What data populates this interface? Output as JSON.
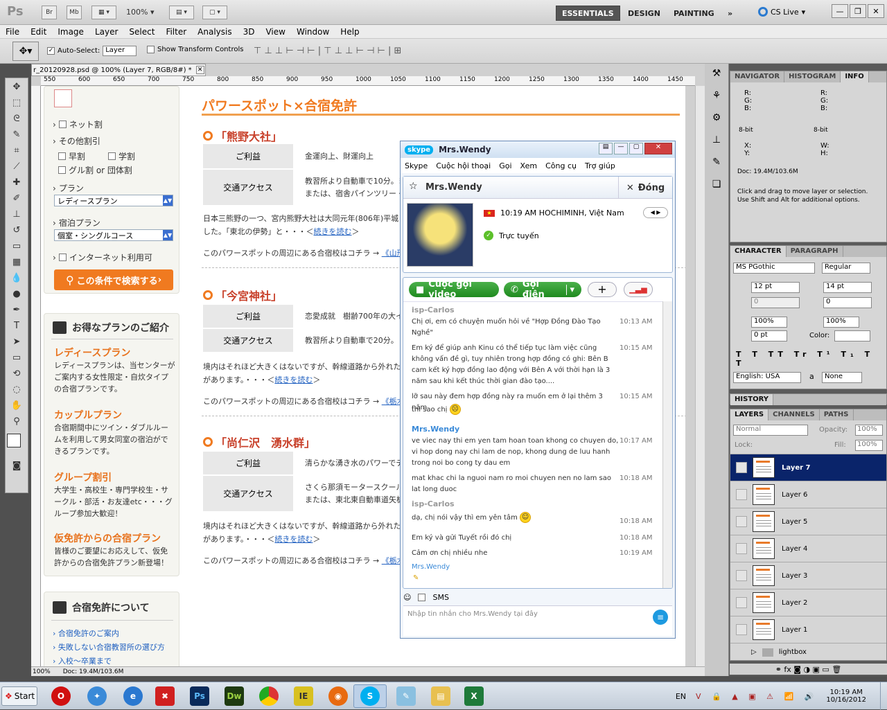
{
  "ps": {
    "logo": "Ps",
    "top_buttons": [
      "Br",
      "Mb"
    ],
    "zoom": "100%",
    "workspaces": [
      "ESSENTIALS",
      "DESIGN",
      "PAINTING"
    ],
    "more_workspaces": "»",
    "cs_live": "CS Live",
    "menu": [
      "File",
      "Edit",
      "Image",
      "Layer",
      "Select",
      "Filter",
      "Analysis",
      "3D",
      "View",
      "Window",
      "Help"
    ],
    "options": {
      "auto_select_label": "Auto-Select:",
      "auto_select_value": "Layer",
      "show_transform": "Show Transform Controls"
    },
    "doc_tab": "r_20120928.psd @ 100% (Layer 7, RGB/8#) *",
    "ruler_marks": [
      "550",
      "600",
      "650",
      "700",
      "750",
      "800",
      "850",
      "900",
      "950",
      "1000",
      "1050",
      "1100",
      "1150",
      "1200",
      "1250",
      "1300",
      "1350",
      "1400",
      "1450"
    ],
    "status_zoom": "100%",
    "status_doc": "Doc: 19.4M/103.6M"
  },
  "site": {
    "sidebar": {
      "net_discount": "ネット割",
      "other_discount": "その他割引",
      "early": "早割",
      "student": "学割",
      "group": "グル割 or 団体割",
      "plan_label": "プラン",
      "plan_value": "レディースプラン",
      "lodging_label": "宿泊プラン",
      "lodging_value": "個室・シングルコース",
      "internet": "インターネット利用可",
      "search_btn": "この条件で検索する",
      "plans_header": "お得なプランのご紹介",
      "plans": [
        {
          "title": "レディースプラン",
          "desc": "レディースプランは、当センターがご案内する女性限定・自炊タイプの合宿プランです。"
        },
        {
          "title": "カップルプラン",
          "desc": "合宿期間中にツイン・ダブルルームを利用して男女同室の宿泊ができるプランです。"
        },
        {
          "title": "グループ割引",
          "desc": "大学生・高校生・専門学校生・サークル・部活・お友達etc・・・グループ参加大歓迎！"
        },
        {
          "title": "仮免許からの合宿プラン",
          "desc": "皆様のご要望にお応えして、仮免許からの合宿免許プラン新登場！"
        }
      ],
      "about_header": "合宿免許について",
      "about_links": [
        "合宿免許のご案内",
        "失敗しない合宿教習所の選び方",
        "入校～卒業まで"
      ]
    },
    "main": {
      "title": "パワースポット×合宿免許",
      "sections": [
        {
          "name": "「熊野大社」",
          "benefit_label": "ご利益",
          "benefit": "金運向上、財運向上",
          "access_label": "交通アクセス",
          "access": "教習所より自動車で10分。ま",
          "access2": "または、宿舎パインツリー・ア",
          "body1": "日本三熊野の一つ、宮内熊野大社は大同元年(806年)平城",
          "body2a": "した。「東北の伊勢」と・・・＜",
          "more": "続きを読む",
          "body2b": "＞",
          "nearby": "このパワースポットの周辺にある合宿校はコチラ → ",
          "nearby_link": "《山形"
        },
        {
          "name": "「今宮神社」",
          "benefit_label": "ご利益",
          "benefit": "恋愛成就　樹齢700年の大イ",
          "access_label": "交通アクセス",
          "access": "教習所より自動車で20分。",
          "body1": "境内はそれほど大きくはないですが、幹線道路から外れた場",
          "body2a": "があります。・・・＜",
          "more": "続きを読む",
          "body2b": "＞",
          "nearby": "このパワースポットの周辺にある合宿校はコチラ → ",
          "nearby_link": "《栃木"
        },
        {
          "name": "「尚仁沢　湧水群」",
          "benefit_label": "ご利益",
          "benefit": "清らかな湧き水のパワーでデ",
          "access_label": "交通アクセス",
          "access": "さくら那須モータースクールよ",
          "access2": "または、東北東自動車道矢板",
          "body1": "境内はそれほど大きくはないですが、幹線道路から外れた場",
          "body2a": "があります。・・・＜",
          "more": "続きを読む",
          "body2b": "＞",
          "nearby": "このパワースポットの周辺にある合宿校はコチラ → ",
          "nearby_link": "《栃木"
        }
      ]
    }
  },
  "panels": {
    "info_tabs": [
      "NAVIGATOR",
      "HISTOGRAM",
      "INFO"
    ],
    "info": {
      "r": "R:",
      "g": "G:",
      "b": "B:",
      "bit": "8-bit",
      "x": "X:",
      "y": "Y:",
      "w": "W:",
      "h": "H:",
      "doc": "Doc: 19.4M/103.6M",
      "hint": "Click and drag to move layer or selection. Use Shift and Alt for additional options."
    },
    "char_tabs": [
      "CHARACTER",
      "PARAGRAPH"
    ],
    "char": {
      "font": "MS PGothic",
      "style": "Regular",
      "size": "12 pt",
      "leading": "14 pt",
      "kern": "0",
      "track": "0",
      "vscale": "100%",
      "hscale": "100%",
      "baseline": "0 pt",
      "color_label": "Color:",
      "lang": "English: USA",
      "aa_label": "a",
      "aa": "None"
    },
    "history_tab": "HISTORY",
    "layer_tabs": [
      "LAYERS",
      "CHANNELS",
      "PATHS"
    ],
    "blend": "Normal",
    "opacity_label": "Opacity:",
    "opacity": "100%",
    "lock_label": "Lock:",
    "fill_label": "Fill:",
    "fill": "100%",
    "layers": [
      "Layer 7",
      "Layer 6",
      "Layer 5",
      "Layer 4",
      "Layer 3",
      "Layer 2",
      "Layer 1"
    ],
    "group": "lightbox"
  },
  "skype": {
    "logo": "skype",
    "title": "Mrs.Wendy",
    "menu": [
      "Skype",
      "Cuộc hội thoại",
      "Gọi",
      "Xem",
      "Công cụ",
      "Trợ giúp"
    ],
    "contact": "Mrs.Wendy",
    "close": "Đóng",
    "time_loc": "10:19 AM HOCHIMINH, Việt Nam",
    "status": "Trực tuyến",
    "video_call": "Cuộc gọi video",
    "call": "Gọi điện",
    "messages": [
      {
        "who": "isp-Carlos",
        "text": "Chị ơi, em có chuyện muốn hỏi về \"Hợp Đồng Đào Tạo Nghề\"",
        "time": "10:13 AM"
      },
      {
        "text": "Em ký để giúp anh Kinu có thể tiếp tục làm việc cũng không vấn đề gì, tuy nhiên trong hợp đồng có ghi: Bên B cam kết ký hợp đồng lao động với Bên A với thời hạn là 3 năm sau khi kết thúc thời gian đào tạo....",
        "time": "10:15 AM"
      },
      {
        "text": "lỡ sau này đem hợp đồng này ra muốn em ở lại thêm 3 năm",
        "time": "10:15 AM"
      },
      {
        "text": "thì sao chị"
      },
      {
        "who": "Mrs.Wendy",
        "text": "ve viec nay thi em yen tam hoan toan khong co chuyen do, vi hop dong nay chi lam de nop, khong dung de luu hanh trong noi bo cong ty dau em",
        "time": "10:17 AM"
      },
      {
        "text": "mat khac chi la nguoi nam ro moi chuyen nen no lam sao lat long duoc",
        "time": "10:18 AM"
      },
      {
        "who": "isp-Carlos",
        "text": "dạ, chị nói vậy thì em yên tâm",
        "time": "10:18 AM"
      },
      {
        "text": "Em ký và gửi Tuyết rồi đó chị",
        "time": "10:18 AM"
      },
      {
        "text": "Cảm ơn chị nhiều nhe",
        "time": "10:19 AM"
      },
      {
        "who": "Mrs.Wendy",
        "text": ""
      }
    ],
    "sms": "SMS",
    "input_placeholder": "Nhập tin nhắn cho Mrs.Wendy tại đây"
  },
  "taskbar": {
    "start": "Start",
    "lang": "EN",
    "time": "10:19 AM",
    "date": "10/16/2012"
  }
}
